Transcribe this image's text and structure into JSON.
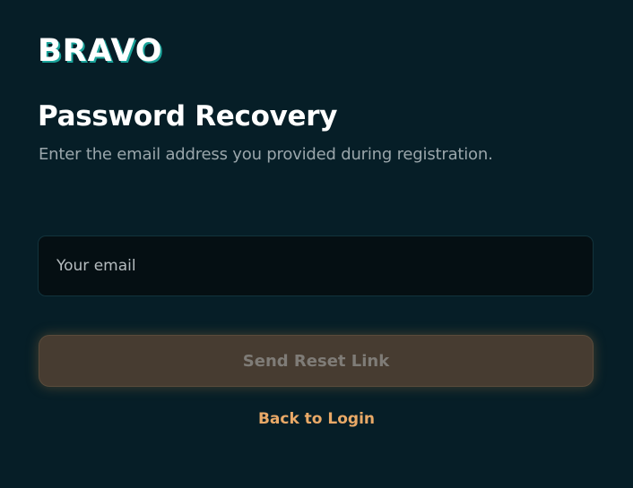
{
  "brand": {
    "logo_text": "BRAVO",
    "accent_color": "#1aa39a"
  },
  "recovery": {
    "title": "Password Recovery",
    "subtitle": "Enter the email address you provided during registration.",
    "email_placeholder": "Your email",
    "email_value": "",
    "submit_label": "Send Reset Link",
    "back_label": "Back to Login"
  },
  "colors": {
    "background": "#071d26",
    "button": "#473c31",
    "link": "#e9a967"
  }
}
